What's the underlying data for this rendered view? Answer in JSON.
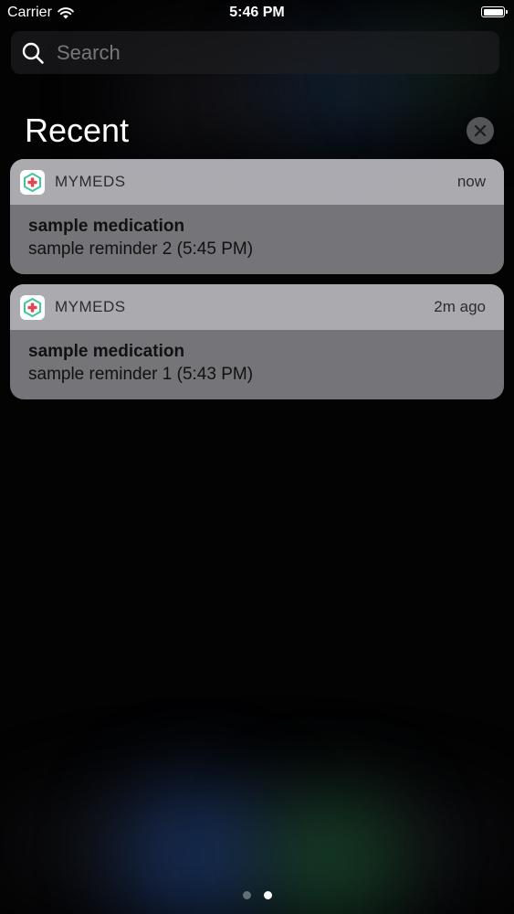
{
  "status_bar": {
    "carrier": "Carrier",
    "time": "5:46 PM",
    "battery_level": 1.0
  },
  "search": {
    "placeholder": "Search"
  },
  "recent": {
    "title": "Recent"
  },
  "notifications": [
    {
      "app_name": "MYMEDS",
      "time": "now",
      "title": "sample medication",
      "message": "sample reminder 2 (5:45 PM)"
    },
    {
      "app_name": "MYMEDS",
      "time": "2m ago",
      "title": "sample medication",
      "message": "sample reminder 1 (5:43 PM)"
    }
  ],
  "page_indicator": {
    "count": 2,
    "active_index": 1
  },
  "icons": {
    "wifi": "wifi-icon",
    "battery": "battery-icon",
    "search": "search-icon",
    "clear": "close-icon",
    "app": "medical-cross-icon"
  },
  "colors": {
    "app_icon_accent": "#e8434a",
    "app_icon_ring": "#3cc79a"
  }
}
